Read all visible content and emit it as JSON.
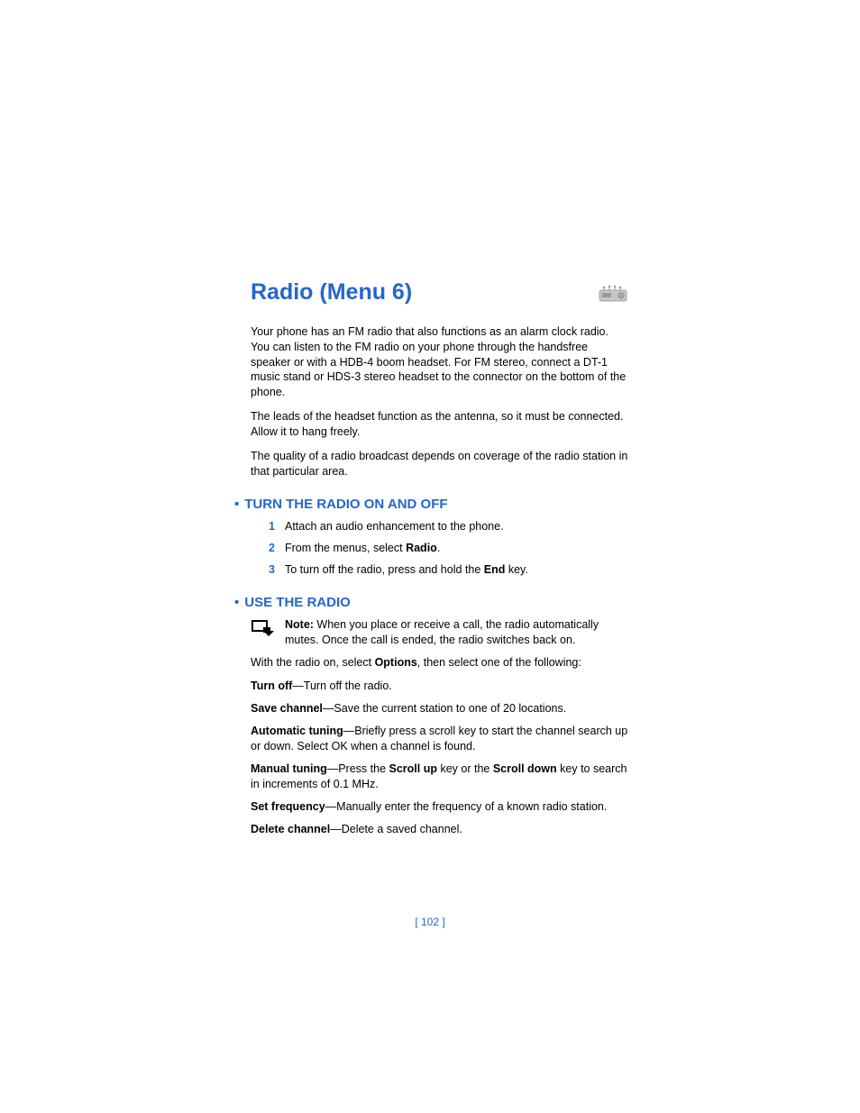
{
  "title": "Radio (Menu 6)",
  "intro": {
    "p1": "Your phone has an FM radio that also functions as an alarm clock radio. You can listen to the FM radio on your phone through the handsfree speaker or with a HDB-4 boom headset. For FM stereo, connect a DT-1 music stand or HDS-3 stereo headset to the connector on the bottom of the phone.",
    "p2": "The leads of the headset function as the antenna, so it must be connected. Allow it to hang freely.",
    "p3": "The quality of a radio broadcast depends on coverage of the radio station in that particular area."
  },
  "section1": {
    "heading": "TURN THE RADIO ON AND OFF",
    "steps": [
      {
        "num": "1",
        "text": "Attach an audio enhancement to the phone."
      },
      {
        "num": "2",
        "pre": "From the menus, select ",
        "bold": "Radio",
        "post": "."
      },
      {
        "num": "3",
        "pre": "To turn off the radio, press and hold the ",
        "bold": "End",
        "post": " key."
      }
    ]
  },
  "section2": {
    "heading": "USE THE RADIO",
    "note": {
      "bold": "Note:",
      "text": " When you place or receive a call, the radio automatically mutes. Once the call is ended, the radio switches back on."
    },
    "lead": {
      "pre": "With the radio on, select ",
      "bold": "Options",
      "post": ", then select one of the following:"
    },
    "options": [
      {
        "term": "Turn off",
        "desc": "—Turn off the radio."
      },
      {
        "term": "Save channel",
        "desc": "—Save the current station to one of 20 locations."
      },
      {
        "term": "Automatic tuning",
        "desc": "—Briefly press a scroll key to start the channel search up or down. Select OK when a channel is found."
      },
      {
        "term": "Manual tuning",
        "desc_pre": "—Press the ",
        "bold1": "Scroll up",
        "mid": " key or the ",
        "bold2": "Scroll down",
        "desc_post": " key to search in increments of 0.1 MHz."
      },
      {
        "term": "Set frequency",
        "desc": "—Manually enter the frequency of a known radio station."
      },
      {
        "term": "Delete channel",
        "desc": "—Delete a saved channel."
      }
    ]
  },
  "pagenum": "[ 102 ]"
}
